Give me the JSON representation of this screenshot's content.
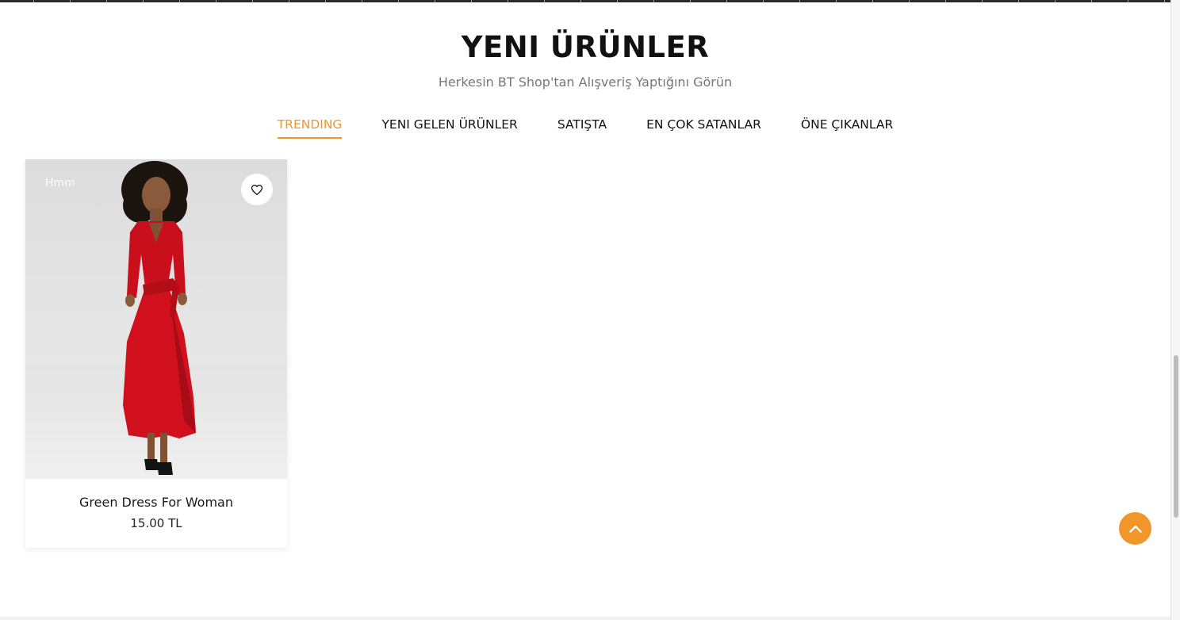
{
  "section": {
    "title": "YENI ÜRÜNLER",
    "subtitle": "Herkesin BT Shop'tan Alışveriş Yaptığını Görün"
  },
  "tabs": [
    {
      "label": "TRENDING",
      "active": true
    },
    {
      "label": "YENI GELEN ÜRÜNLER",
      "active": false
    },
    {
      "label": "SATIŞTA",
      "active": false
    },
    {
      "label": "EN ÇOK SATANLAR",
      "active": false
    },
    {
      "label": "ÖNE ÇIKANLAR",
      "active": false
    }
  ],
  "products": [
    {
      "badge": "Hmm",
      "name": "Green Dress For Woman",
      "price": "15.00 TL",
      "wishlist_icon": "heart-icon"
    }
  ],
  "back_to_top_icon": "chevron-up-icon",
  "colors": {
    "accent": "#f0962a",
    "dress": "#d0101c"
  }
}
